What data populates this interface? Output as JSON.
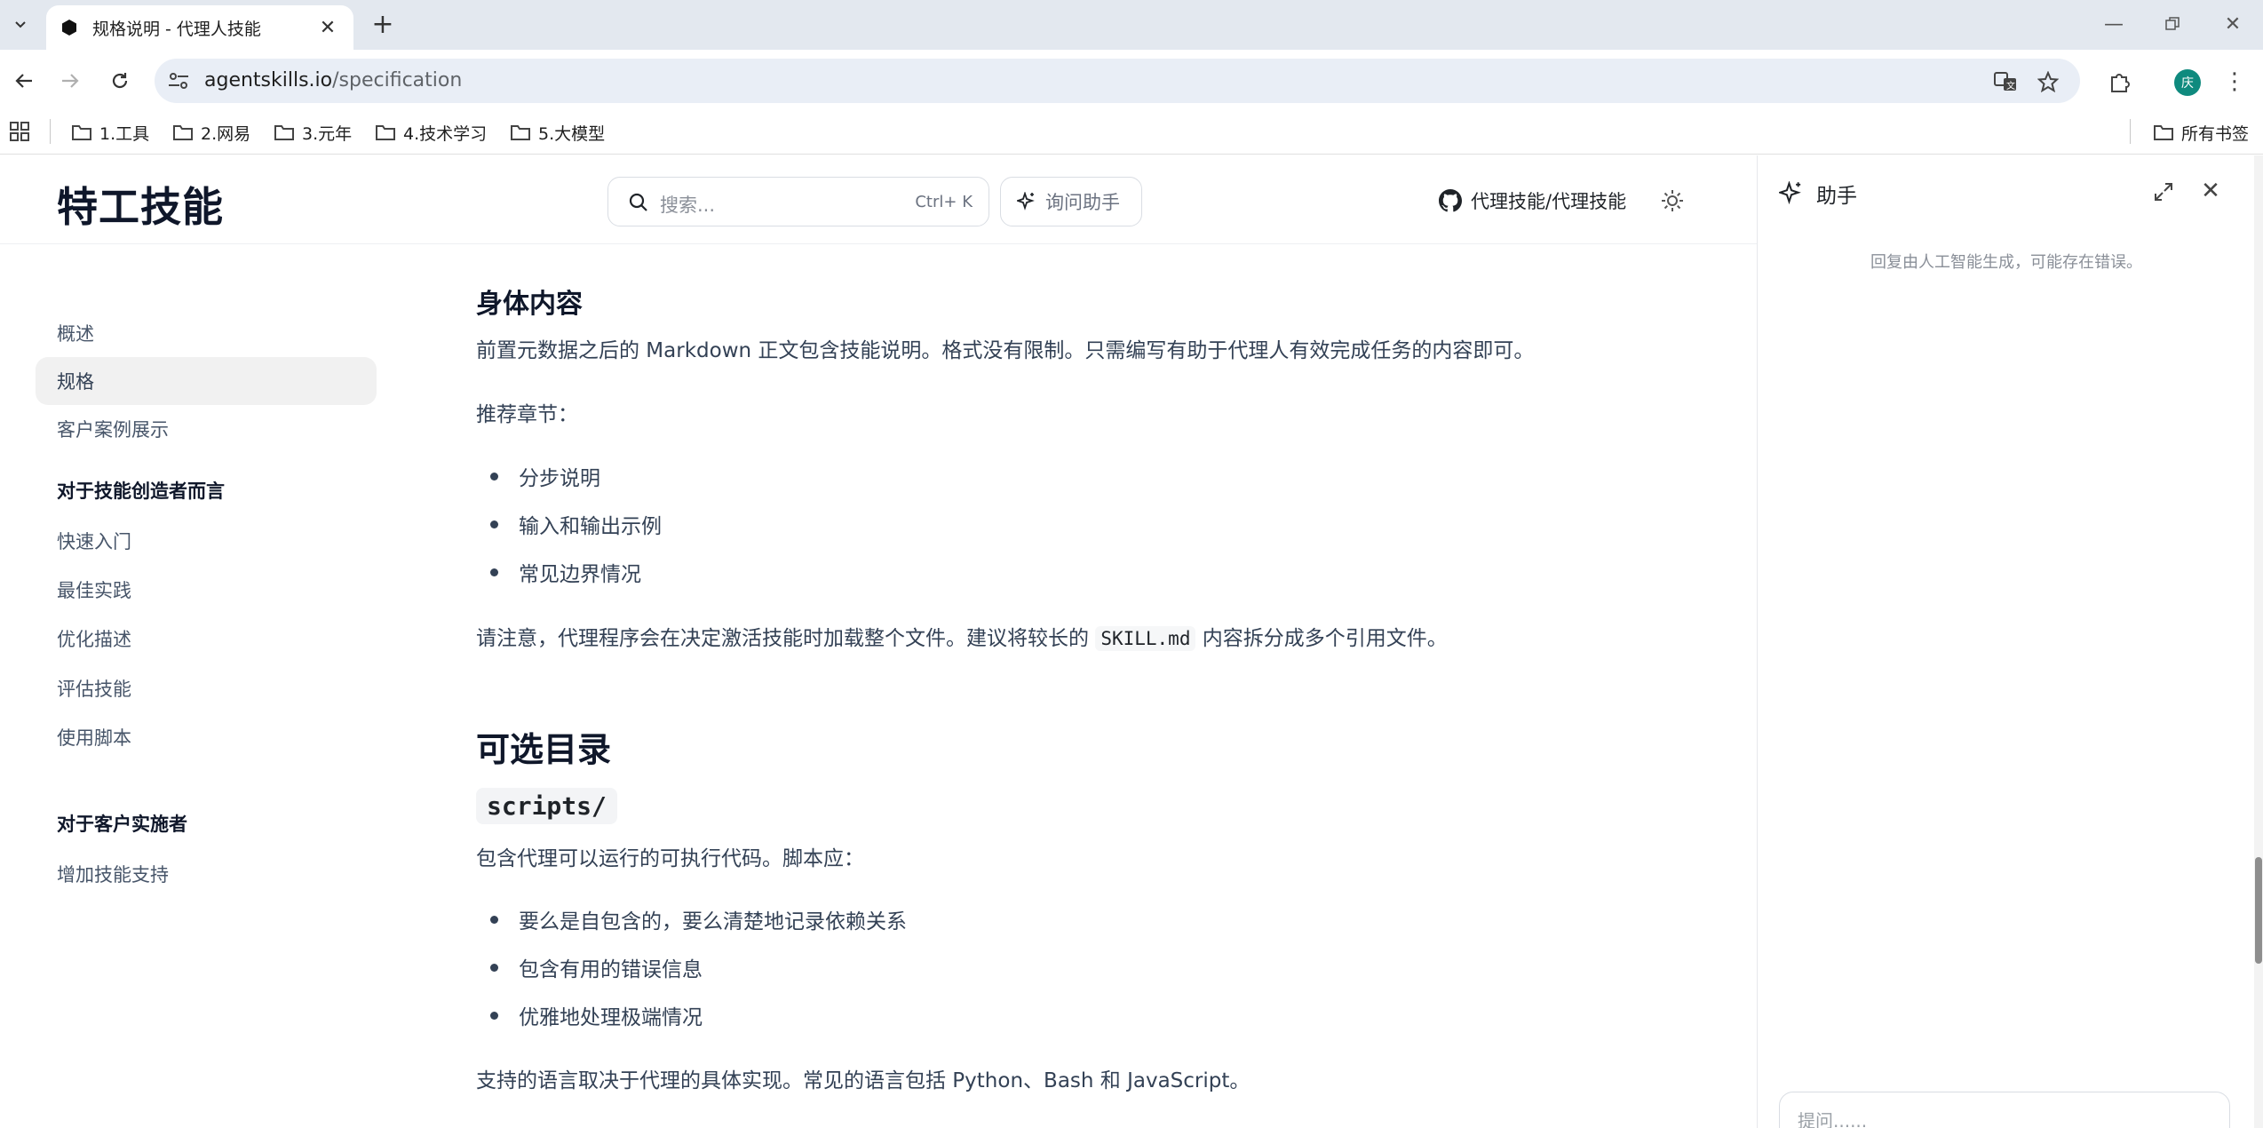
{
  "browser": {
    "tab_title": "规格说明 - 代理人技能",
    "url_host": "agentskills.io",
    "url_path": "/specification",
    "avatar_letter": "庆",
    "bookmarks": [
      "1.工具",
      "2.网易",
      "3.元年",
      "4.技术学习",
      "5.大模型"
    ],
    "all_bookmarks": "所有书签"
  },
  "header": {
    "site_title": "特工技能",
    "search_placeholder": "搜索...",
    "search_shortcut": "Ctrl+ K",
    "ask_button": "询问助手",
    "github_link": "代理技能/代理技能"
  },
  "sidebar": {
    "items": [
      "概述",
      "规格",
      "客户案例展示"
    ],
    "section1_title": "对于技能创造者而言",
    "section1_items": [
      "快速入门",
      "最佳实践",
      "优化描述",
      "评估技能",
      "使用脚本"
    ],
    "section2_title": "对于客户实施者",
    "section2_items": [
      "增加技能支持"
    ]
  },
  "content": {
    "h_body": "身体内容",
    "p_body": "前置元数据之后的 Markdown 正文包含技能说明。格式没有限制。只需编写有助于代理人有效完成任务的内容即可。",
    "p_recommended": "推荐章节：",
    "recommended_items": [
      "分步说明",
      "输入和输出示例",
      "常见边界情况"
    ],
    "p_note_before": "请注意，代理程序会在决定激活技能时加载整个文件。建议将较长的 ",
    "p_note_code": "SKILL.md",
    "p_note_after": " 内容拆分成多个引用文件。",
    "h_optional": "可选目录",
    "scripts_heading": "scripts/",
    "p_scripts": "包含代理可以运行的可执行代码。脚本应：",
    "scripts_items": [
      "要么是自包含的，要么清楚地记录依赖关系",
      "包含有用的错误信息",
      "优雅地处理极端情况"
    ],
    "p_languages": "支持的语言取决于代理的具体实现。常见的语言包括 Python、Bash 和 JavaScript。"
  },
  "assistant": {
    "title": "助手",
    "disclaimer": "回复由人工智能生成，可能存在错误。",
    "input_placeholder": "提问......"
  }
}
